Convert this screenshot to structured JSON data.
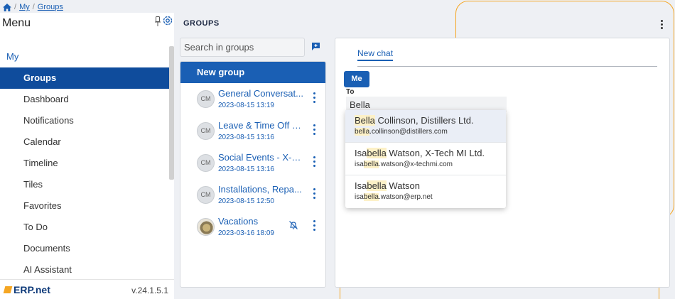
{
  "breadcrumb": {
    "items": [
      "My",
      "Groups"
    ],
    "separator": "/"
  },
  "sidebar": {
    "title": "Menu",
    "section": "My",
    "items": [
      {
        "label": "Groups",
        "active": true
      },
      {
        "label": "Dashboard",
        "active": false
      },
      {
        "label": "Notifications",
        "active": false
      },
      {
        "label": "Calendar",
        "active": false
      },
      {
        "label": "Timeline",
        "active": false
      },
      {
        "label": "Tiles",
        "active": false
      },
      {
        "label": "Favorites",
        "active": false
      },
      {
        "label": "To Do",
        "active": false
      },
      {
        "label": "Documents",
        "active": false
      },
      {
        "label": "AI Assistant",
        "active": false
      }
    ],
    "logo_text": "ERP.net",
    "version": "v.24.1.5.1"
  },
  "groups": {
    "title": "GROUPS",
    "search_placeholder": "Search in groups",
    "new_group_label": "New group",
    "list": [
      {
        "name": "General Conversat...",
        "date": "2023-08-15 13:19",
        "avatar": "CM",
        "muted": false
      },
      {
        "name": "Leave & Time Off - ...",
        "date": "2023-08-15 13:16",
        "avatar": "CM",
        "muted": false
      },
      {
        "name": "Social Events - X-T...",
        "date": "2023-08-15 13:16",
        "avatar": "CM",
        "muted": false
      },
      {
        "name": "Installations, Repa...",
        "date": "2023-08-15 12:50",
        "avatar": "CM",
        "muted": false
      },
      {
        "name": "Vacations",
        "date": "2023-03-16 18:09",
        "avatar": "",
        "muted": true
      }
    ]
  },
  "chat": {
    "tab_label": "New chat",
    "me_chip": "Me",
    "to_label": "To",
    "to_value": "Bella",
    "suggestions": [
      {
        "name_pre": "",
        "name_match": "Bella",
        "name_post": " Collinson, Distillers Ltd.",
        "email_pre": "",
        "email_match": "bella",
        "email_post": ".collinson@distillers.com"
      },
      {
        "name_pre": "Isa",
        "name_match": "bella",
        "name_post": " Watson, X-Tech MI Ltd.",
        "email_pre": "isa",
        "email_match": "bella",
        "email_post": ".watson@x-techmi.com"
      },
      {
        "name_pre": "Isa",
        "name_match": "bella",
        "name_post": " Watson",
        "email_pre": "isa",
        "email_match": "bella",
        "email_post": ".watson@erp.net"
      }
    ]
  },
  "colors": {
    "primary": "#1a5fb4",
    "active_menu": "#0f4c9c",
    "accent": "#f5a623"
  },
  "icons": [
    "home-icon",
    "pin-icon",
    "gear-icon",
    "new-chat-icon",
    "more-vert-icon",
    "bell-off-icon"
  ]
}
